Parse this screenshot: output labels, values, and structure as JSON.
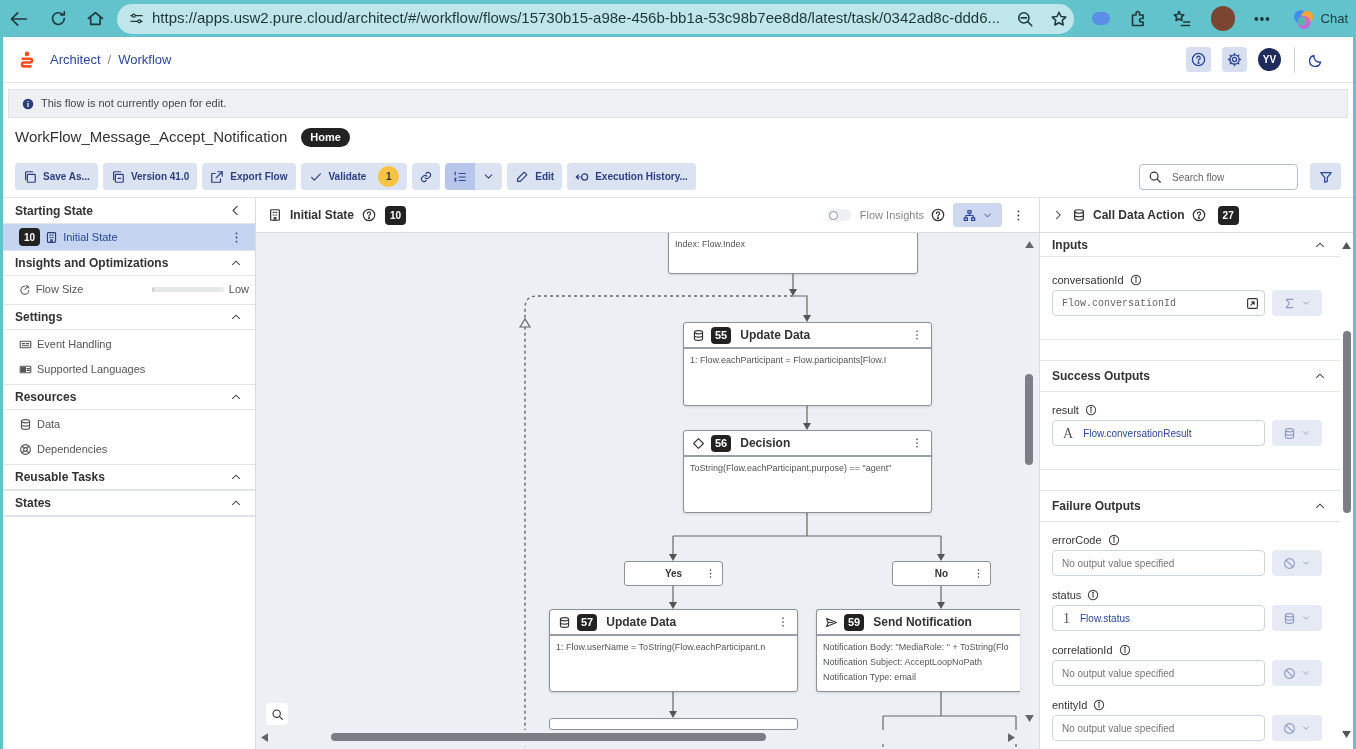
{
  "browser": {
    "url": "https://apps.usw2.pure.cloud/architect/#/workflow/flows/15730b15-a98e-456b-bb1a-53c98b7ee8d8/latest/task/0342ad8c-ddd6...",
    "chat": "Chat"
  },
  "header": {
    "breadcrumb": [
      "Architect",
      "Workflow"
    ],
    "separator": "/",
    "avatar": "YV"
  },
  "notice": "This flow is not currently open for edit.",
  "flow": {
    "name": "WorkFlow_Message_Accept_Notification",
    "badge": "Home"
  },
  "toolbar": [
    {
      "kind": "save",
      "label": "Save As..."
    },
    {
      "kind": "version",
      "label": "Version 41.0"
    },
    {
      "kind": "export",
      "label": "Export Flow"
    },
    {
      "kind": "validate",
      "label": "Validate",
      "count": "1"
    },
    {
      "kind": "link"
    },
    {
      "kind": "view",
      "selected": true
    },
    {
      "kind": "edit",
      "label": "Edit"
    },
    {
      "kind": "history",
      "label": "Execution History..."
    }
  ],
  "search": {
    "placeholder": "Search flow"
  },
  "sidebar": {
    "sections": [
      {
        "kind": "starting",
        "title": "Starting State",
        "items": [
          {
            "badge": "10",
            "label": "Initial State",
            "selected": true
          }
        ]
      },
      {
        "kind": "group",
        "title": "Insights and Optimizations",
        "expanded": true,
        "items": [
          {
            "kind": "meter",
            "label": "Flow Size",
            "level": 0.03,
            "reading": "Low"
          }
        ]
      },
      {
        "kind": "group",
        "title": "Settings",
        "expanded": true,
        "items": [
          {
            "kind": "events",
            "label": "Event Handling"
          },
          {
            "kind": "languages",
            "label": "Supported Languages"
          }
        ]
      },
      {
        "kind": "group",
        "title": "Resources",
        "expanded": true,
        "items": [
          {
            "kind": "data",
            "label": "Data"
          },
          {
            "kind": "dependencies",
            "label": "Dependencies"
          }
        ]
      },
      {
        "kind": "group",
        "title": "Reusable Tasks",
        "expanded": true
      },
      {
        "kind": "group",
        "title": "States",
        "expanded": true
      }
    ]
  },
  "canvas": {
    "title": "Initial State",
    "badge": "10",
    "insights": {
      "label": "Flow Insights",
      "on": false
    },
    "nodes": [
      {
        "kind": "loop",
        "lines": [
          "Index: Flow.Index"
        ]
      },
      {
        "kind": "update",
        "number": "55",
        "title": "Update Data",
        "lines": [
          "1: Flow.eachParticipant = Flow.participants[Flow.I"
        ]
      },
      {
        "kind": "decision",
        "number": "56",
        "title": "Decision",
        "lines": [
          "ToString(Flow.eachParticipant.purpose) == \"agent\""
        ]
      },
      {
        "kind": "update",
        "number": "57",
        "title": "Update Data",
        "lines": [
          "1: Flow.userName = ToString(Flow.eachParticipant.n"
        ]
      },
      {
        "kind": "notify",
        "number": "59",
        "title": "Send Notification",
        "lines": [
          "Notification Body: \"MediaRole: \" + ToString(Flo",
          "Notification Subject: AcceptLoopNoPath",
          "Notification Type: email"
        ]
      }
    ],
    "branches": [
      {
        "label": "Yes"
      },
      {
        "label": "No"
      }
    ]
  },
  "panel": {
    "title": "Call Data Action",
    "badge": "27",
    "sections": [
      {
        "title": "Inputs",
        "expanded": true,
        "fields": [
          {
            "label": "conversationId",
            "kind": "expression",
            "value": "Flow.conversationId"
          }
        ]
      },
      {
        "title": "Success Outputs",
        "expanded": true,
        "fields": [
          {
            "label": "result",
            "kind": "variable",
            "prefix": "A",
            "value": "Flow.conversationResult"
          }
        ]
      },
      {
        "title": "Failure Outputs",
        "expanded": true,
        "fields": [
          {
            "label": "errorCode",
            "kind": "empty",
            "placeholder": "No output value specified"
          },
          {
            "label": "status",
            "kind": "variable",
            "prefix": "1",
            "value": "Flow.status"
          },
          {
            "label": "correlationId",
            "kind": "empty",
            "placeholder": "No output value specified"
          },
          {
            "label": "entityId",
            "kind": "empty",
            "placeholder": "No output value specified"
          }
        ]
      }
    ]
  }
}
